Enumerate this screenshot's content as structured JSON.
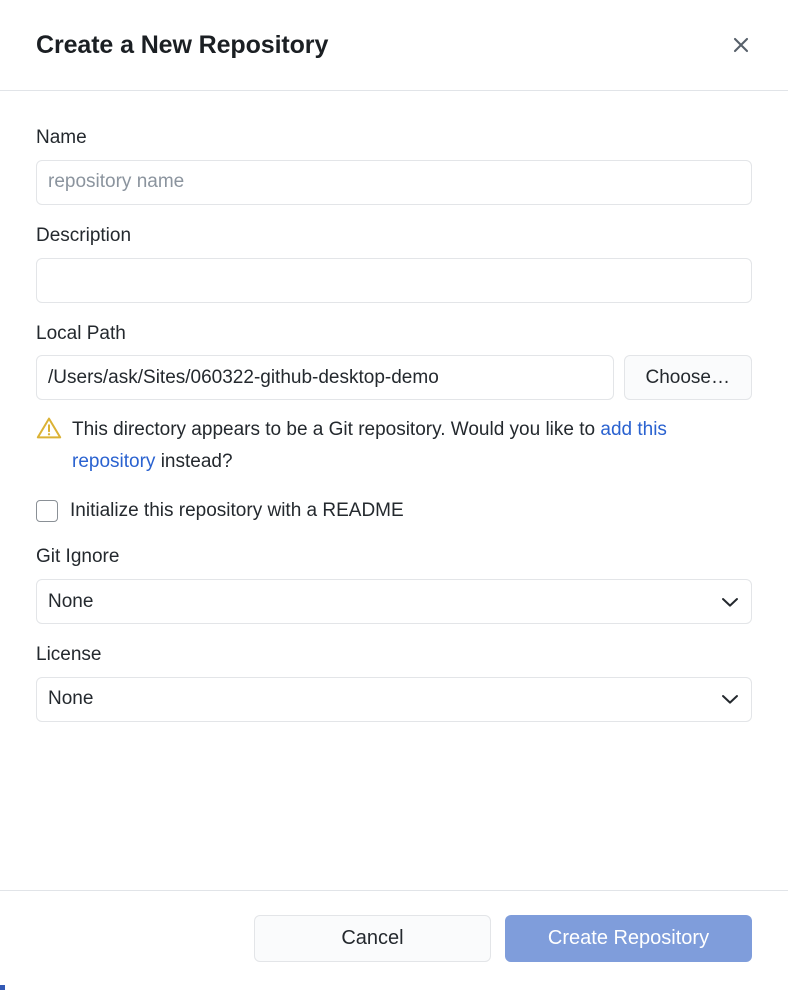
{
  "dialog": {
    "title": "Create a New Repository",
    "close_icon": "close-icon"
  },
  "form": {
    "name": {
      "label": "Name",
      "value": "",
      "placeholder": "repository name"
    },
    "description": {
      "label": "Description",
      "value": "",
      "placeholder": ""
    },
    "local_path": {
      "label": "Local Path",
      "value": "/Users/ask/Sites/060322-github-desktop-demo",
      "choose_button": "Choose…"
    },
    "warning": {
      "icon": "warning-triangle-icon",
      "text_before": "This directory appears to be a Git repository. Would you like to ",
      "link_text": "add this repository",
      "text_after": " instead?",
      "icon_color": "#dbb235",
      "link_color": "#2a62d0"
    },
    "readme_checkbox": {
      "label": "Initialize this repository with a README",
      "checked": false
    },
    "git_ignore": {
      "label": "Git Ignore",
      "value": "None",
      "chevron_icon": "chevron-down-icon"
    },
    "license": {
      "label": "License",
      "value": "None",
      "chevron_icon": "chevron-down-icon"
    }
  },
  "footer": {
    "cancel_label": "Cancel",
    "create_label": "Create Repository",
    "primary_color": "#7f9ddb"
  }
}
